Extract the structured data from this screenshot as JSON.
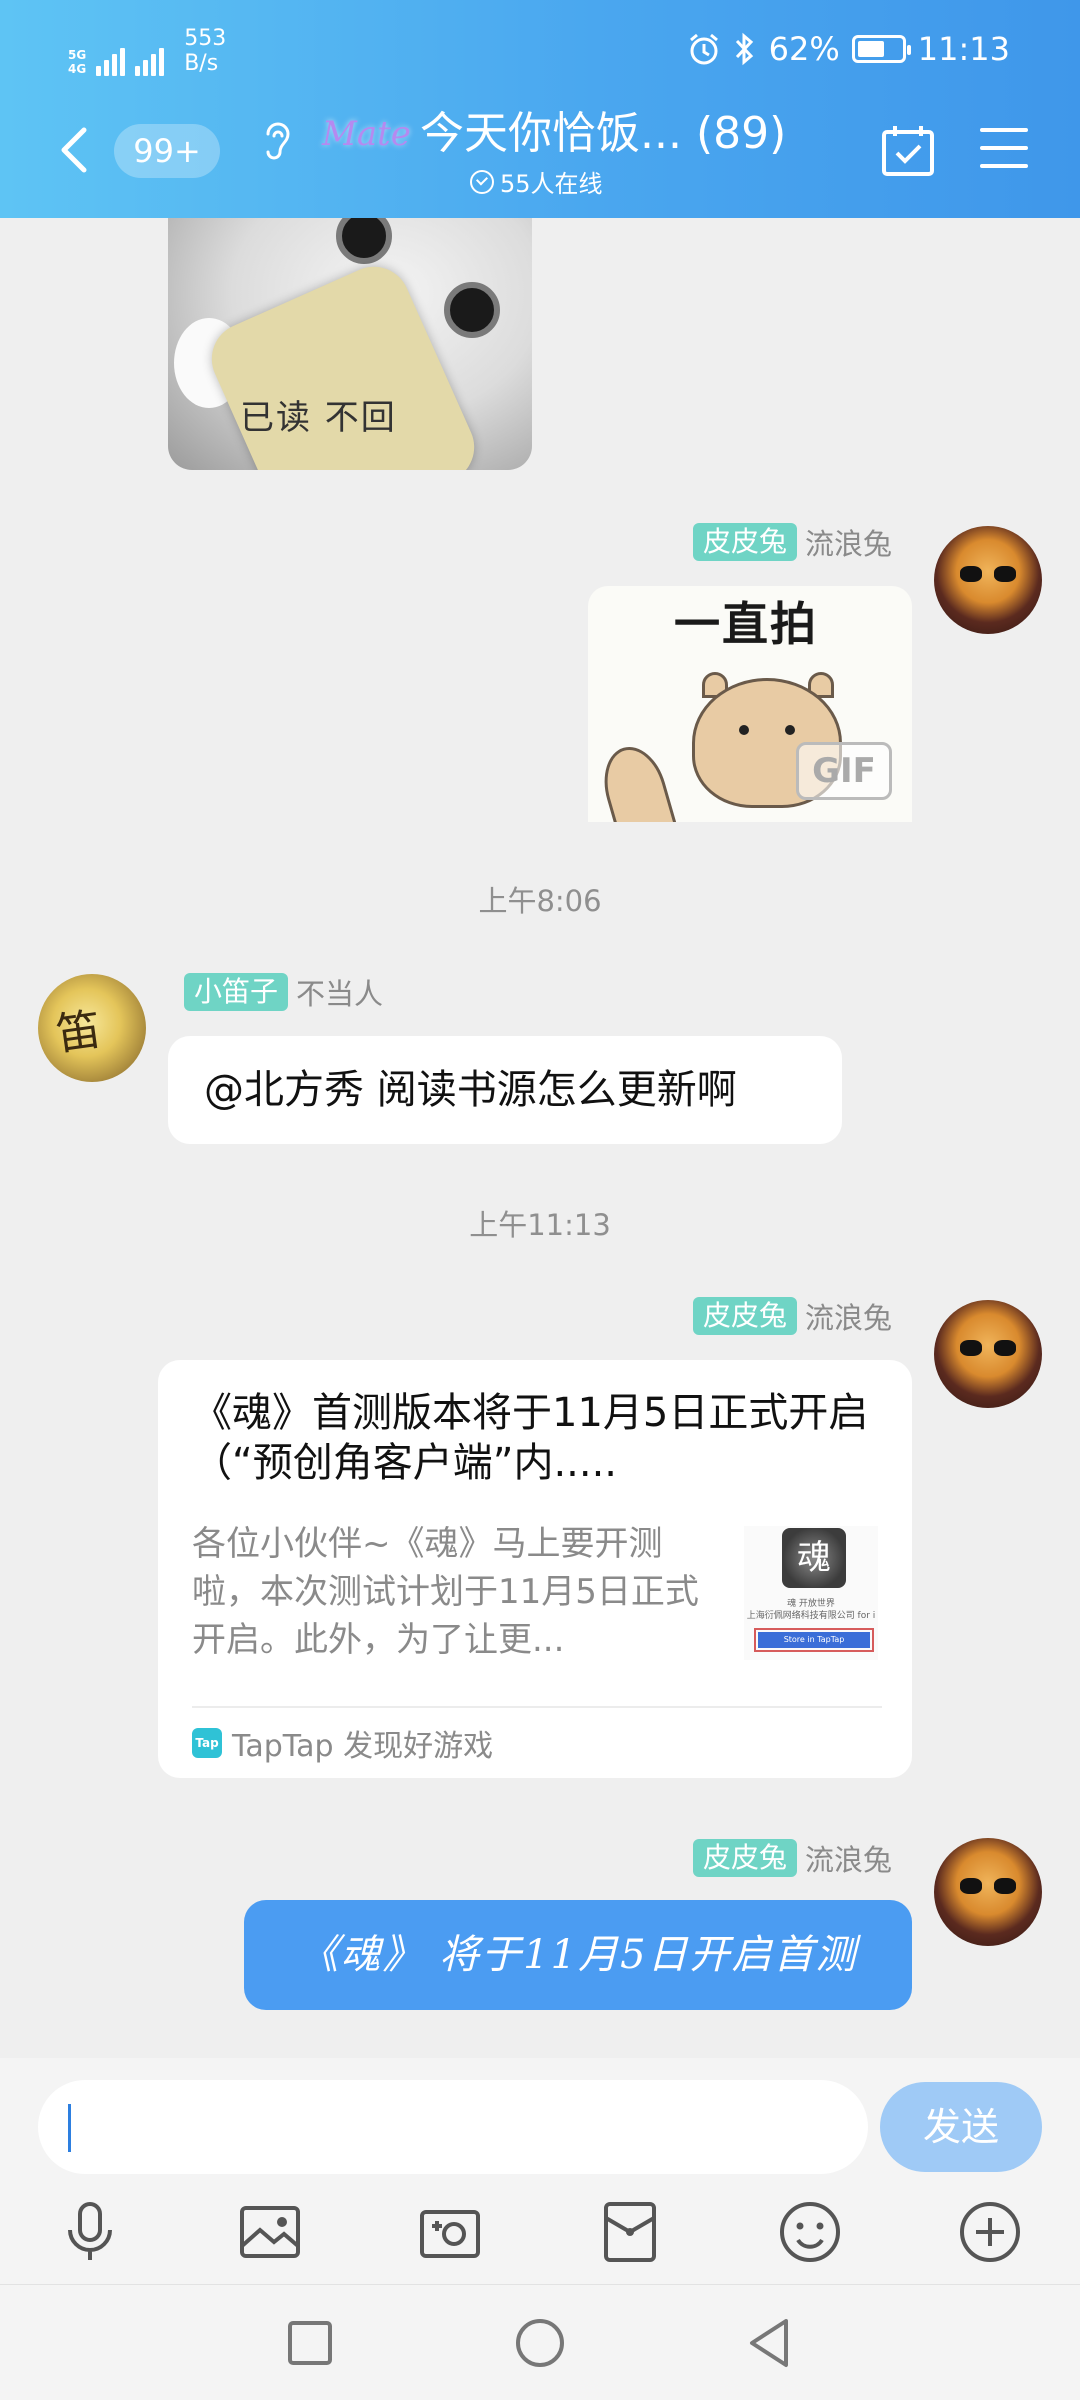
{
  "status_bar": {
    "network_top": "5G",
    "network_bottom": "4G",
    "speed_value": "553",
    "speed_unit": "B/s",
    "battery_percent": "62%",
    "battery_level": 0.62,
    "time": "11:13"
  },
  "header": {
    "unread_count": "99+",
    "logo_text": "Mate",
    "group_title": "今天你恰饭... (89)",
    "online_text": "55人在线"
  },
  "messages": {
    "cat_image_text": "已读    不回",
    "msg1": {
      "tag": "皮皮兔",
      "nick": "流浪兔",
      "gif_caption": "一直拍",
      "gif_badge": "GIF"
    },
    "time1": "上午8:06",
    "msg2": {
      "tag": "小笛子",
      "nick": "不当人",
      "text": "@北方秀 阅读书源怎么更新啊",
      "avatar_text": "笛"
    },
    "time2": "上午11:13",
    "msg3": {
      "tag": "皮皮兔",
      "nick": "流浪兔",
      "card_title": "《魂》首测版本将于11月5日正式开启（“预创角客户端”内.....",
      "card_desc": "各位小伙伴~《魂》马上要开测啦，本次测试计划于11月5日正式开启。此外，为了让更...",
      "thumb_emblem": "魂",
      "thumb_line1": "魂 开放世界",
      "thumb_line2": "上海衍佩网络科技有限公司 for i",
      "thumb_button": "Store in TapTap",
      "source_icon": "Tap",
      "source_text": "TapTap 发现好游戏"
    },
    "msg4": {
      "tag": "皮皮兔",
      "nick": "流浪兔",
      "text": "《魂》 将于11月5日开启首测"
    }
  },
  "input": {
    "value": "",
    "send_label": "发送"
  },
  "colors": {
    "header_gradient_start": "#5ec4f4",
    "header_gradient_end": "#3f97ea",
    "tag_teal": "#6fd4c5",
    "bubble_blue": "#4b9cf2",
    "send_button": "#9fcaf6"
  },
  "icons": {
    "header": [
      "back-icon",
      "ear-icon",
      "calendar-check-icon",
      "menu-icon"
    ],
    "toolbar": [
      "microphone-icon",
      "image-icon",
      "camera-icon",
      "red-packet-icon",
      "emoji-icon",
      "plus-icon"
    ],
    "navbar": [
      "recent-apps-icon",
      "home-icon",
      "back-triangle-icon"
    ]
  }
}
